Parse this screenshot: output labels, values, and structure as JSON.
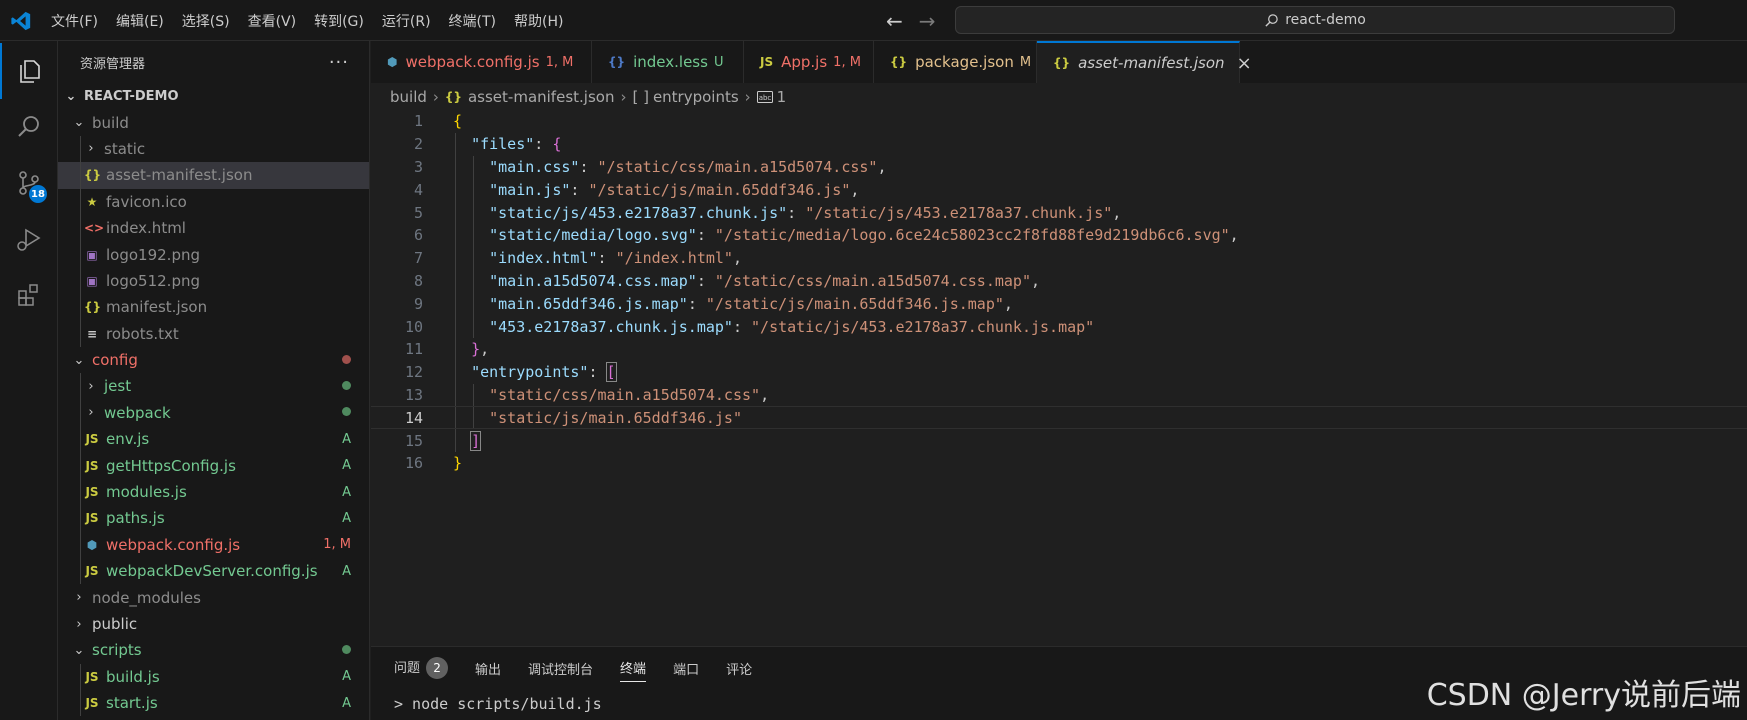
{
  "titlebar": {
    "menu": [
      "文件(F)",
      "编辑(E)",
      "选择(S)",
      "查看(V)",
      "转到(G)",
      "运行(R)",
      "终端(T)",
      "帮助(H)"
    ],
    "search": "react-demo"
  },
  "activity": {
    "scm_badge": "18"
  },
  "sidebar": {
    "title": "资源管理器",
    "more": "···",
    "root": "REACT-DEMO",
    "items": [
      {
        "label": "build",
        "type": "folder-open",
        "depth": 1,
        "color": "gray"
      },
      {
        "label": "static",
        "type": "folder",
        "depth": 2,
        "color": "gray"
      },
      {
        "label": "asset-manifest.json",
        "type": "json",
        "depth": 2,
        "color": "gray",
        "selected": true
      },
      {
        "label": "favicon.ico",
        "type": "star",
        "depth": 2,
        "color": "gray"
      },
      {
        "label": "index.html",
        "type": "html",
        "depth": 2,
        "color": "gray"
      },
      {
        "label": "logo192.png",
        "type": "image",
        "depth": 2,
        "color": "gray"
      },
      {
        "label": "logo512.png",
        "type": "image",
        "depth": 2,
        "color": "gray"
      },
      {
        "label": "manifest.json",
        "type": "json",
        "depth": 2,
        "color": "gray"
      },
      {
        "label": "robots.txt",
        "type": "text",
        "depth": 2,
        "color": "gray"
      },
      {
        "label": "config",
        "type": "folder-open",
        "depth": 1,
        "color": "red",
        "dot": "red"
      },
      {
        "label": "jest",
        "type": "folder",
        "depth": 2,
        "color": "green",
        "dot": "green"
      },
      {
        "label": "webpack",
        "type": "folder",
        "depth": 2,
        "color": "green",
        "dot": "green"
      },
      {
        "label": "env.js",
        "type": "js",
        "depth": 2,
        "color": "green",
        "status": "A"
      },
      {
        "label": "getHttpsConfig.js",
        "type": "js",
        "depth": 2,
        "color": "green",
        "status": "A"
      },
      {
        "label": "modules.js",
        "type": "js",
        "depth": 2,
        "color": "green",
        "status": "A"
      },
      {
        "label": "paths.js",
        "type": "js",
        "depth": 2,
        "color": "green",
        "status": "A"
      },
      {
        "label": "webpack.config.js",
        "type": "webpack",
        "depth": 2,
        "color": "red",
        "status": "1, M"
      },
      {
        "label": "webpackDevServer.config.js",
        "type": "js",
        "depth": 2,
        "color": "green",
        "status": "A"
      },
      {
        "label": "node_modules",
        "type": "folder",
        "depth": 1,
        "color": "gray"
      },
      {
        "label": "public",
        "type": "folder",
        "depth": 1,
        "color": "white"
      },
      {
        "label": "scripts",
        "type": "folder-open",
        "depth": 1,
        "color": "green",
        "dot": "green"
      },
      {
        "label": "build.js",
        "type": "js",
        "depth": 2,
        "color": "green",
        "status": "A"
      },
      {
        "label": "start.js",
        "type": "js",
        "depth": 2,
        "color": "green",
        "status": "A"
      }
    ]
  },
  "tabs": [
    {
      "icon": "webpack",
      "label": "webpack.config.js",
      "status": "1, M",
      "color": "red"
    },
    {
      "icon": "less",
      "label": "index.less",
      "status": "U",
      "color": "green"
    },
    {
      "icon": "js",
      "label": "App.js",
      "status": "1, M",
      "color": "red"
    },
    {
      "icon": "json",
      "label": "package.json",
      "status": "M",
      "color": "yellow"
    },
    {
      "icon": "json",
      "label": "asset-manifest.json",
      "status": "",
      "color": "italic",
      "active": true
    }
  ],
  "breadcrumbs": [
    "build",
    "asset-manifest.json",
    "entrypoints",
    "1"
  ],
  "editor": {
    "current_line": 14,
    "lines": [
      {
        "n": "1",
        "tokens": [
          [
            "b1",
            "{"
          ]
        ]
      },
      {
        "n": "2",
        "tokens": [
          [
            "p",
            "  "
          ],
          [
            "k",
            "\"files\""
          ],
          [
            "p",
            ": "
          ],
          [
            "b2",
            "{"
          ]
        ]
      },
      {
        "n": "3",
        "tokens": [
          [
            "p",
            "    "
          ],
          [
            "k",
            "\"main.css\""
          ],
          [
            "p",
            ": "
          ],
          [
            "s",
            "\"/static/css/main.a15d5074.css\""
          ],
          [
            "p",
            ","
          ]
        ]
      },
      {
        "n": "4",
        "tokens": [
          [
            "p",
            "    "
          ],
          [
            "k",
            "\"main.js\""
          ],
          [
            "p",
            ": "
          ],
          [
            "s",
            "\"/static/js/main.65ddf346.js\""
          ],
          [
            "p",
            ","
          ]
        ]
      },
      {
        "n": "5",
        "tokens": [
          [
            "p",
            "    "
          ],
          [
            "k",
            "\"static/js/453.e2178a37.chunk.js\""
          ],
          [
            "p",
            ": "
          ],
          [
            "s",
            "\"/static/js/453.e2178a37.chunk.js\""
          ],
          [
            "p",
            ","
          ]
        ]
      },
      {
        "n": "6",
        "tokens": [
          [
            "p",
            "    "
          ],
          [
            "k",
            "\"static/media/logo.svg\""
          ],
          [
            "p",
            ": "
          ],
          [
            "s",
            "\"/static/media/logo.6ce24c58023cc2f8fd88fe9d219db6c6.svg\""
          ],
          [
            "p",
            ","
          ]
        ]
      },
      {
        "n": "7",
        "tokens": [
          [
            "p",
            "    "
          ],
          [
            "k",
            "\"index.html\""
          ],
          [
            "p",
            ": "
          ],
          [
            "s",
            "\"/index.html\""
          ],
          [
            "p",
            ","
          ]
        ]
      },
      {
        "n": "8",
        "tokens": [
          [
            "p",
            "    "
          ],
          [
            "k",
            "\"main.a15d5074.css.map\""
          ],
          [
            "p",
            ": "
          ],
          [
            "s",
            "\"/static/css/main.a15d5074.css.map\""
          ],
          [
            "p",
            ","
          ]
        ]
      },
      {
        "n": "9",
        "tokens": [
          [
            "p",
            "    "
          ],
          [
            "k",
            "\"main.65ddf346.js.map\""
          ],
          [
            "p",
            ": "
          ],
          [
            "s",
            "\"/static/js/main.65ddf346.js.map\""
          ],
          [
            "p",
            ","
          ]
        ]
      },
      {
        "n": "10",
        "tokens": [
          [
            "p",
            "    "
          ],
          [
            "k",
            "\"453.e2178a37.chunk.js.map\""
          ],
          [
            "p",
            ": "
          ],
          [
            "s",
            "\"/static/js/453.e2178a37.chunk.js.map\""
          ]
        ]
      },
      {
        "n": "11",
        "tokens": [
          [
            "p",
            "  "
          ],
          [
            "b2",
            "}"
          ],
          [
            "p",
            ","
          ]
        ]
      },
      {
        "n": "12",
        "tokens": [
          [
            "p",
            "  "
          ],
          [
            "k",
            "\"entrypoints\""
          ],
          [
            "p",
            ": "
          ],
          [
            "b2",
            "["
          ]
        ]
      },
      {
        "n": "13",
        "tokens": [
          [
            "p",
            "    "
          ],
          [
            "s",
            "\"static/css/main.a15d5074.css\""
          ],
          [
            "p",
            ","
          ]
        ]
      },
      {
        "n": "14",
        "tokens": [
          [
            "p",
            "    "
          ],
          [
            "s",
            "\"static/js/main.65ddf346.js\""
          ]
        ]
      },
      {
        "n": "15",
        "tokens": [
          [
            "p",
            "  "
          ],
          [
            "b2",
            "]"
          ]
        ]
      },
      {
        "n": "16",
        "tokens": [
          [
            "b1",
            "}"
          ]
        ]
      }
    ]
  },
  "panel": {
    "tabs": [
      "问题",
      "输出",
      "调试控制台",
      "终端",
      "端口",
      "评论"
    ],
    "problems_count": "2",
    "active_tab": "终端",
    "terminal_line": "> node scripts/build.js"
  },
  "watermark": "CSDN @Jerry说前后端",
  "colors": {
    "accent": "#0078d4",
    "git_added": "#73c991",
    "git_modified": "#f07068",
    "json_key": "#9cdcfe",
    "json_string": "#ce9178"
  }
}
